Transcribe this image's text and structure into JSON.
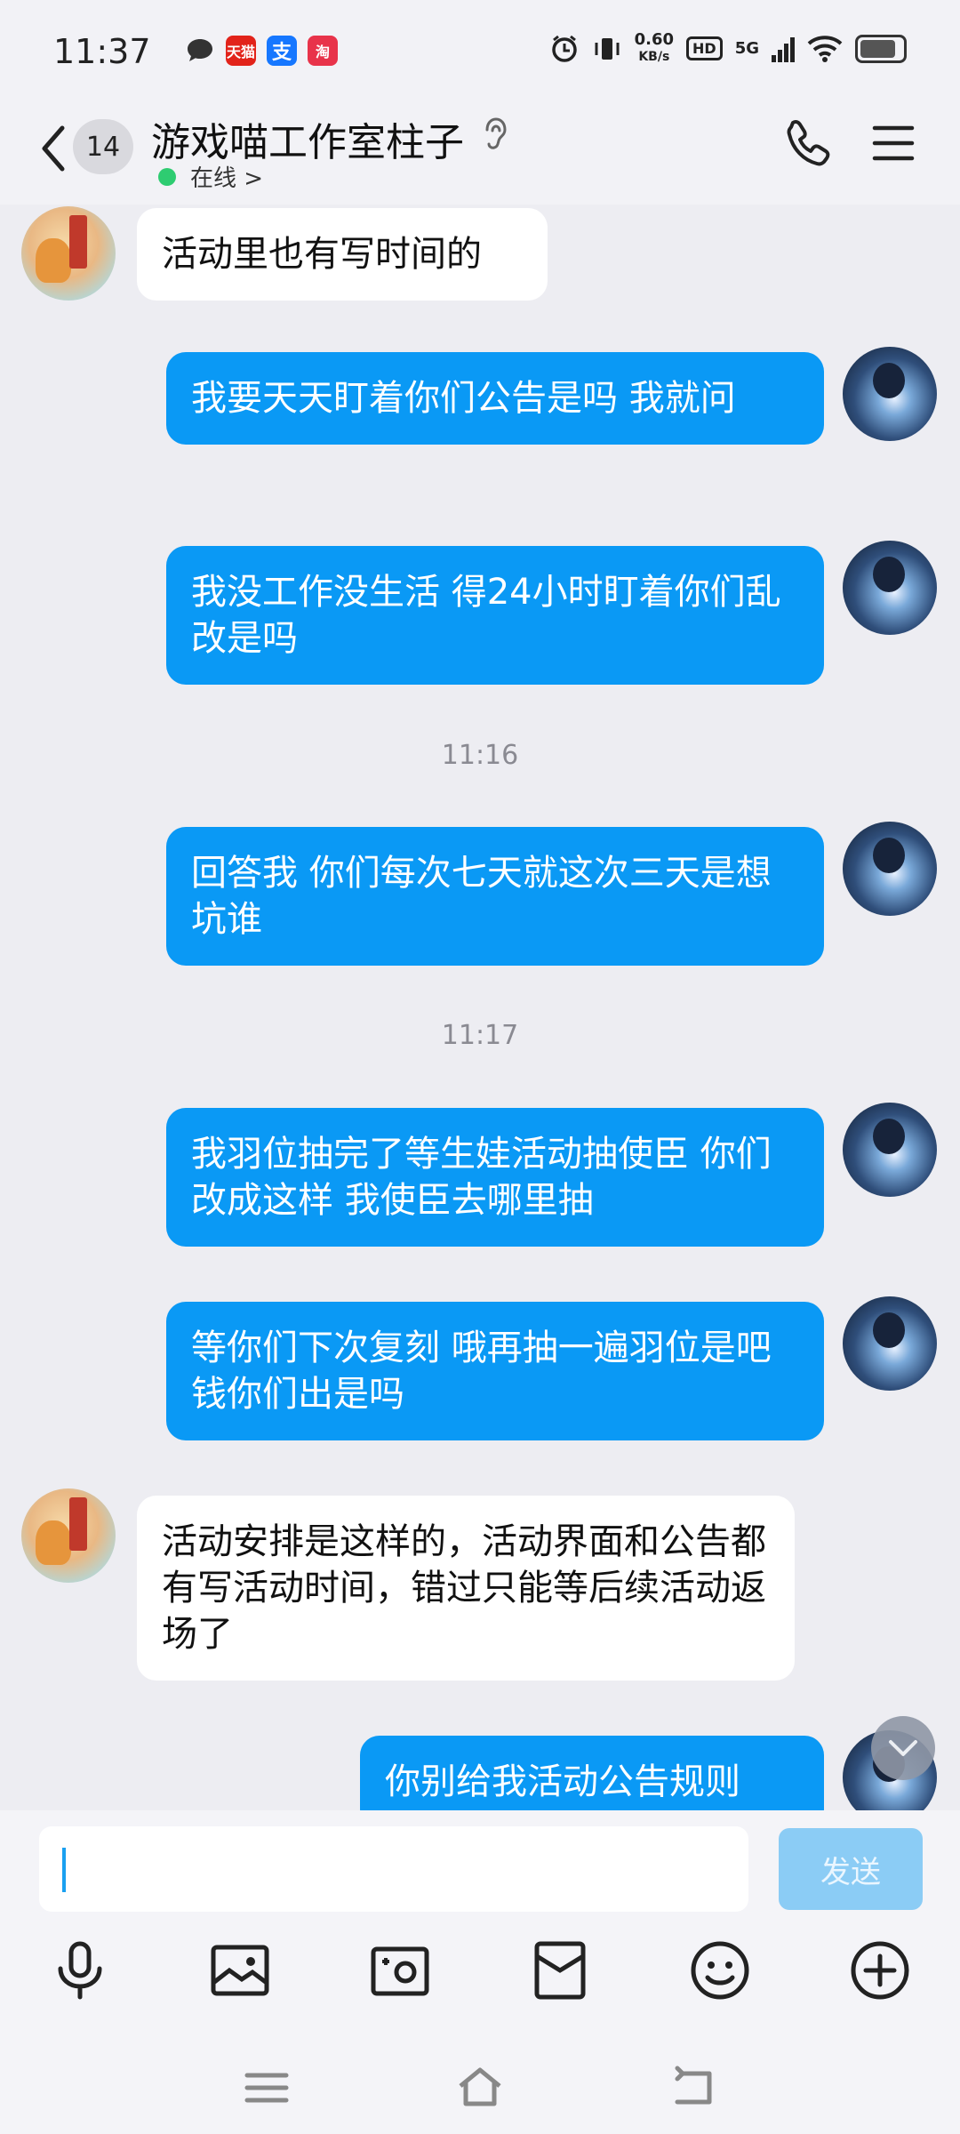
{
  "status_bar": {
    "time": "11:37",
    "app_icons": [
      {
        "name": "message-icon",
        "label": "",
        "color": "#333333"
      },
      {
        "name": "tmall-icon",
        "label": "天猫",
        "color": "#e2231a"
      },
      {
        "name": "alipay-icon",
        "label": "支",
        "color": "#1677ff"
      },
      {
        "name": "taobao-icon",
        "label": "淘",
        "color": "#e8334a"
      }
    ],
    "net_speed_value": "0.60",
    "net_speed_unit": "KB/s",
    "hd": "HD",
    "network": "5G",
    "battery_level": 0.75
  },
  "header": {
    "unread_count": "14",
    "contact_name": "游戏喵工作室柱子",
    "status": "在线 >",
    "status_color": "#2ecc71"
  },
  "messages": [
    {
      "side": "left",
      "text": "活动里也有写时间的"
    },
    {
      "side": "right",
      "text": "我要天天盯着你们公告是吗 我就问"
    },
    {
      "side": "right",
      "text": "我没工作没生活 得24小时盯着你们乱改是吗"
    },
    {
      "side": "time",
      "text": "11:16"
    },
    {
      "side": "right",
      "text": "回答我 你们每次七天就这次三天是想坑谁"
    },
    {
      "side": "time",
      "text": "11:17"
    },
    {
      "side": "right",
      "text": "我羽位抽完了等生娃活动抽使臣 你们改成这样 我使臣去哪里抽"
    },
    {
      "side": "right",
      "text": "等你们下次复刻 哦再抽一遍羽位是吧 钱你们出是吗"
    },
    {
      "side": "left",
      "text": "活动安排是这样的，活动界面和公告都有写活动时间，错过只能等后续活动返场了"
    },
    {
      "side": "right",
      "text": "你别给我活动公告规则"
    }
  ],
  "composer": {
    "input_value": "",
    "send_label": "发送"
  },
  "colors": {
    "accent": "#0a99f5",
    "background": "#ededf2",
    "send_disabled": "#8bccf5"
  }
}
